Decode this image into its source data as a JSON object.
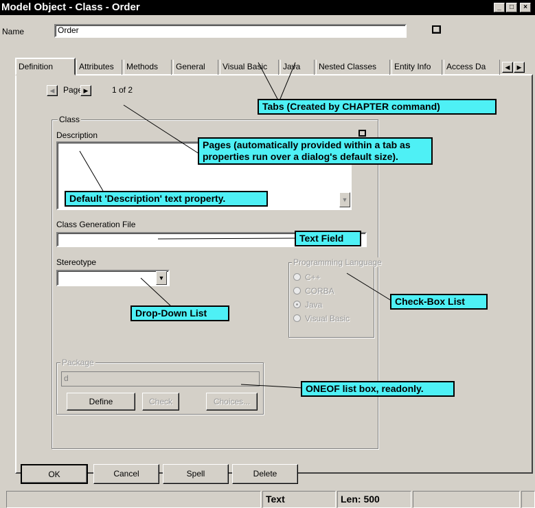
{
  "window": {
    "title": "Model Object - Class - Order",
    "controls": [
      "_",
      "□",
      "×"
    ]
  },
  "name_row": {
    "label": "Name",
    "value": "Order"
  },
  "tabs": [
    {
      "label": "Definition",
      "active": true
    },
    {
      "label": "Attributes"
    },
    {
      "label": "Methods"
    },
    {
      "label": "General"
    },
    {
      "label": "Visual Basic"
    },
    {
      "label": "Java"
    },
    {
      "label": "Nested Classes"
    },
    {
      "label": "Entity Info"
    },
    {
      "label": "Access Da"
    }
  ],
  "pager": {
    "label": "Page",
    "count": "1 of 2"
  },
  "class_group": {
    "legend": "Class",
    "description_label": "Description",
    "generation_label": "Class Generation File",
    "stereotype_label": "Stereotype"
  },
  "language": {
    "legend": "Programming Language",
    "options": [
      {
        "label": "C++",
        "checked": false
      },
      {
        "label": "CORBA",
        "checked": false
      },
      {
        "label": "Java",
        "checked": true
      },
      {
        "label": "Visual Basic",
        "checked": false
      }
    ]
  },
  "package": {
    "legend": "Package",
    "value": "d",
    "buttons": [
      "Define",
      "Check",
      "Choices..."
    ]
  },
  "callouts": {
    "tabs": "Tabs (Created by CHAPTER command)",
    "pages": "Pages (automatically provided within a tab as properties run over a dialog's default size).",
    "description": "Default 'Description' text property.",
    "text_field": "Text Field",
    "dropdown": "Drop-Down List",
    "checkbox": "Check-Box List",
    "oneof": "ONEOF list box, readonly."
  },
  "footer_buttons": [
    "OK",
    "Cancel",
    "Spell",
    "Delete"
  ],
  "status": {
    "mode": "Text",
    "len": "Len: 500"
  },
  "colors": {
    "callout": "#4ef0f5",
    "dialog": "#d4d0c8",
    "titlebar": "#000000"
  }
}
